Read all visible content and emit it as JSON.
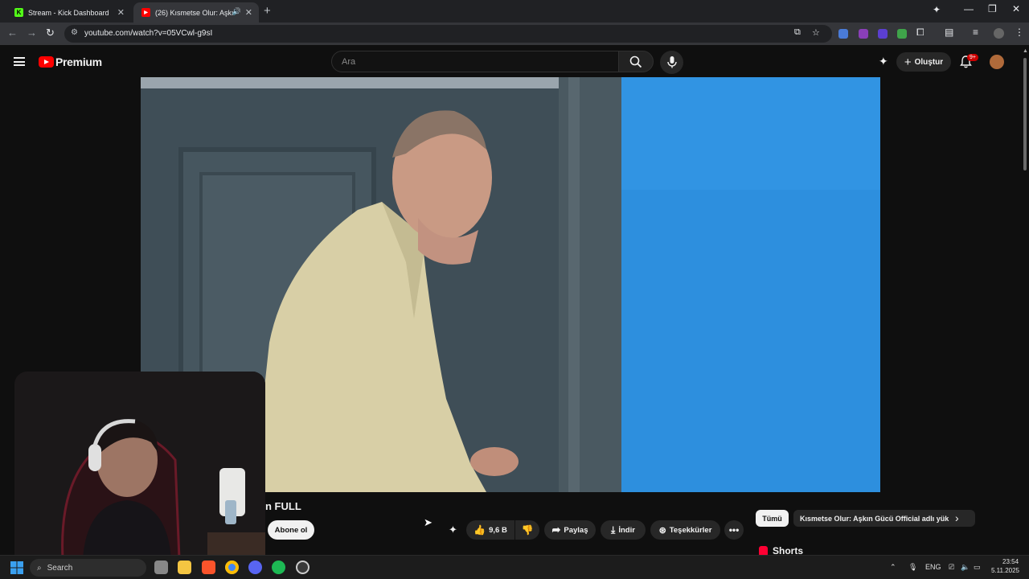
{
  "browser": {
    "tabs": [
      {
        "label": "Stream - Kick Dashboard",
        "favicon": "K"
      },
      {
        "label": "(26) Kısmetse Olur: Aşkın G",
        "favicon": "▶"
      }
    ],
    "url": "youtube.com/watch?v=05VCwl-g9sI"
  },
  "youtube": {
    "logo_label": "Premium",
    "search_placeholder": "Ara",
    "create_label": "Oluştur",
    "notification_count": "9+"
  },
  "video_info": {
    "title_fragment": "n FULL",
    "subscribe_label": "Abone ol",
    "like_count": "9,6 B",
    "share_label": "Paylaş",
    "download_label": "İndir",
    "thanks_label": "Teşekkürler"
  },
  "sidebar": {
    "chips": [
      {
        "label": "Tümü",
        "selected": true
      },
      {
        "label": "Kısmetse Olur: Aşkın Gücü Official adlı yük",
        "selected": false
      }
    ],
    "shorts_label": "Shorts"
  },
  "taskbar": {
    "search_label": "Search",
    "language": "ENG",
    "time": "23:54",
    "date": "5.11.2025"
  },
  "colors": {
    "youtube_red": "#ff0000",
    "background": "#0f0f0f",
    "video_blue": "#2d8fde"
  }
}
